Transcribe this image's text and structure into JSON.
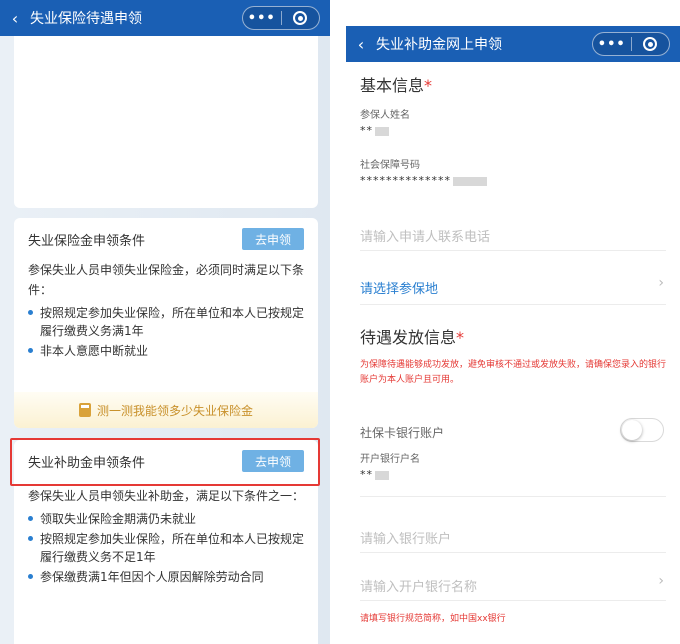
{
  "left": {
    "nav": {
      "back_icon": "‹",
      "title": "失业保险待遇申领",
      "more": "•••"
    },
    "card1": {
      "title": "失业保险金申领条件",
      "apply_label": "去申领",
      "desc": "参保失业人员申领失业保险金，必须同时满足以下条件：",
      "conditions": [
        "按照规定参加失业保险，所在单位和本人已按规定履行缴费义务满1年",
        "非本人意愿中断就业"
      ],
      "calc_label": "测一测我能领多少失业保险金"
    },
    "card2": {
      "title": "失业补助金申领条件",
      "apply_label": "去申领",
      "desc": "参保失业人员申领失业补助金，满足以下条件之一：",
      "conditions": [
        "领取失业保险金期满仍未就业",
        "按照规定参加失业保险，所在单位和本人已按规定履行缴费义务不足1年",
        "参保缴费满1年但因个人原因解除劳动合同"
      ]
    }
  },
  "right": {
    "nav": {
      "back_icon": "‹",
      "title": "失业补助金网上申领",
      "more": "•••"
    },
    "basic": {
      "title": "基本信息",
      "required": "*",
      "name_label": "参保人姓名",
      "name_value": "**",
      "ssn_label": "社会保障号码",
      "ssn_value": "**************",
      "phone_placeholder": "请输入申请人联系电话",
      "region_label": "请选择参保地"
    },
    "payout": {
      "title": "待遇发放信息",
      "required": "*",
      "notice": "为保障待遇能够成功发放，避免审核不通过或发放失败，请确保您录入的银行账户为本人账户且可用。",
      "bank_card_label": "社保卡银行账户",
      "bank_card_toggle": false,
      "holder_label": "开户银行户名",
      "holder_value": "**",
      "account_placeholder": "请输入银行账户",
      "bank_name_placeholder": "请输入开户银行名称",
      "bank_tip": "请填写银行规范简称，如中国xx银行"
    }
  },
  "colors": {
    "nav": "#1a5fb4",
    "accent": "#2a7fd0",
    "apply_button": "#6fb1e4",
    "required": "#e53935",
    "highlight": "#e53935"
  },
  "icons": [
    "back-arrow-icon",
    "more-icon",
    "close-circle-icon",
    "bullet-icon",
    "calculator-icon",
    "chevron-right-icon",
    "toggle-switch"
  ]
}
